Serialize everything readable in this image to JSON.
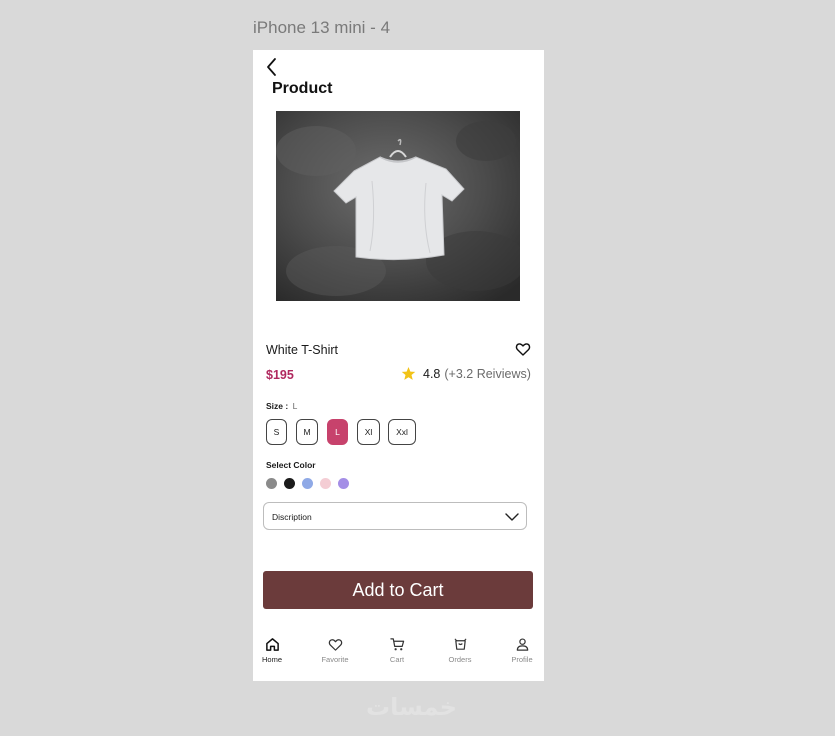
{
  "frame_label": "iPhone 13 mini - 4",
  "header": {
    "title": "Product"
  },
  "product": {
    "name": "White T-Shirt",
    "price": "$195",
    "rating": "4.8",
    "reviews": "(+3.2 Reiviews)",
    "rating_color": "#f2c318"
  },
  "size": {
    "label": "Size :",
    "selected_text": "L",
    "options": [
      "S",
      "M",
      "L",
      "Xl",
      "Xxl"
    ],
    "active_color": "#c7426c"
  },
  "colors": {
    "label": "Select Color",
    "swatches": [
      "#8a8a8a",
      "#1b1b1b",
      "#8fa9e6",
      "#f4cdd4",
      "#a48ee6"
    ]
  },
  "description": {
    "label": "Discription"
  },
  "cart": {
    "label": "Add to Cart",
    "color": "#6b3b3b"
  },
  "tabs": [
    {
      "label": "Home",
      "icon": "home-icon"
    },
    {
      "label": "Favorite",
      "icon": "heart-icon"
    },
    {
      "label": "Cart",
      "icon": "cart-icon"
    },
    {
      "label": "Orders",
      "icon": "orders-icon"
    },
    {
      "label": "Profile",
      "icon": "profile-icon"
    }
  ],
  "watermark": "خمسات"
}
